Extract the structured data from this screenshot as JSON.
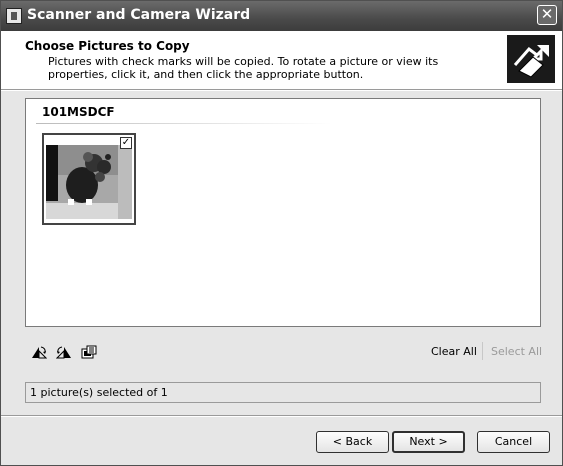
{
  "window": {
    "title": "Scanner and Camera Wizard",
    "close_label": "✕"
  },
  "header": {
    "title": "Choose Pictures to Copy",
    "description": "Pictures with check marks will be copied. To rotate a picture or view its properties, click it, and then click the appropriate button."
  },
  "listview": {
    "group_name": "101MSDCF",
    "items": [
      {
        "checked": true,
        "check_glyph": "✓"
      }
    ]
  },
  "toolbar": {
    "icons": [
      "rotate-clockwise-icon",
      "rotate-counterclockwise-icon",
      "properties-icon"
    ],
    "clear_all": "Clear All",
    "select_all": "Select All"
  },
  "status": {
    "text": "1 picture(s) selected of 1"
  },
  "buttons": {
    "back": "< Back",
    "next": "Next >",
    "cancel": "Cancel"
  }
}
